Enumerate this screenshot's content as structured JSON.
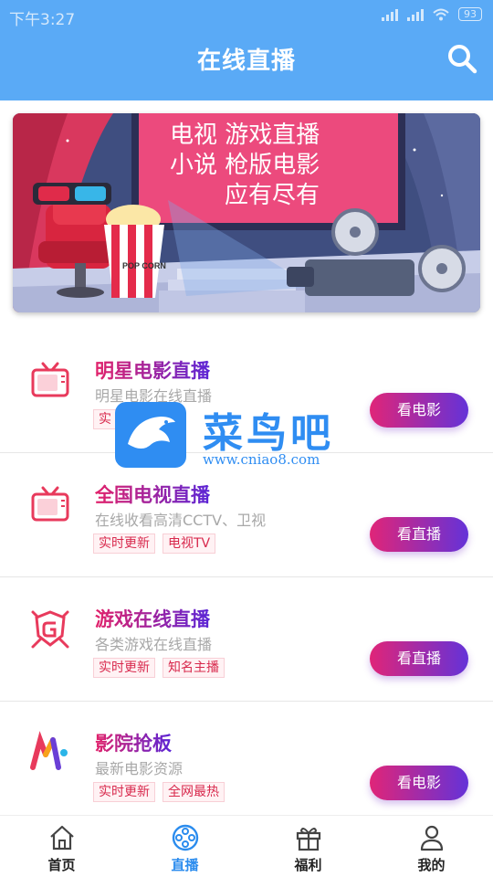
{
  "status_bar": {
    "time": "下午3:27",
    "battery": "93"
  },
  "header": {
    "title": "在线直播"
  },
  "banner": {
    "lines": [
      "电视 游戏直播",
      "小说 枪版电影",
      "应有尽有"
    ],
    "popcorn_label": "POP CORN"
  },
  "items": [
    {
      "title": "明星电影直播",
      "subtitle": "明星电影在线直播",
      "tags": [
        "实"
      ],
      "button": "看电影",
      "icon": "tv-icon"
    },
    {
      "title": "全国电视直播",
      "subtitle": "在线收看高清CCTV、卫视",
      "tags": [
        "实时更新",
        "电视TV"
      ],
      "button": "看直播",
      "icon": "tv-icon"
    },
    {
      "title": "游戏在线直播",
      "subtitle": "各类游戏在线直播",
      "tags": [
        "实时更新",
        "知名主播"
      ],
      "button": "看直播",
      "icon": "game-shield-icon"
    },
    {
      "title": "影院抢板",
      "subtitle": "最新电影资源",
      "tags": [
        "实时更新",
        "全网最热"
      ],
      "button": "看电影",
      "icon": "colorful-m-logo-icon"
    }
  ],
  "watermark": {
    "name": "菜鸟吧",
    "url": "www.cniao8.com"
  },
  "tabs": [
    {
      "label": "首页",
      "icon": "home-icon",
      "active": false
    },
    {
      "label": "直播",
      "icon": "film-reel-icon",
      "active": true
    },
    {
      "label": "福利",
      "icon": "gift-icon",
      "active": false
    },
    {
      "label": "我的",
      "icon": "user-icon",
      "active": false
    }
  ],
  "colors": {
    "header": "#5aaaf6",
    "accent_start": "#e02578",
    "accent_end": "#6432d8",
    "tab_active": "#2b8cee",
    "tag_text": "#d8294d"
  }
}
